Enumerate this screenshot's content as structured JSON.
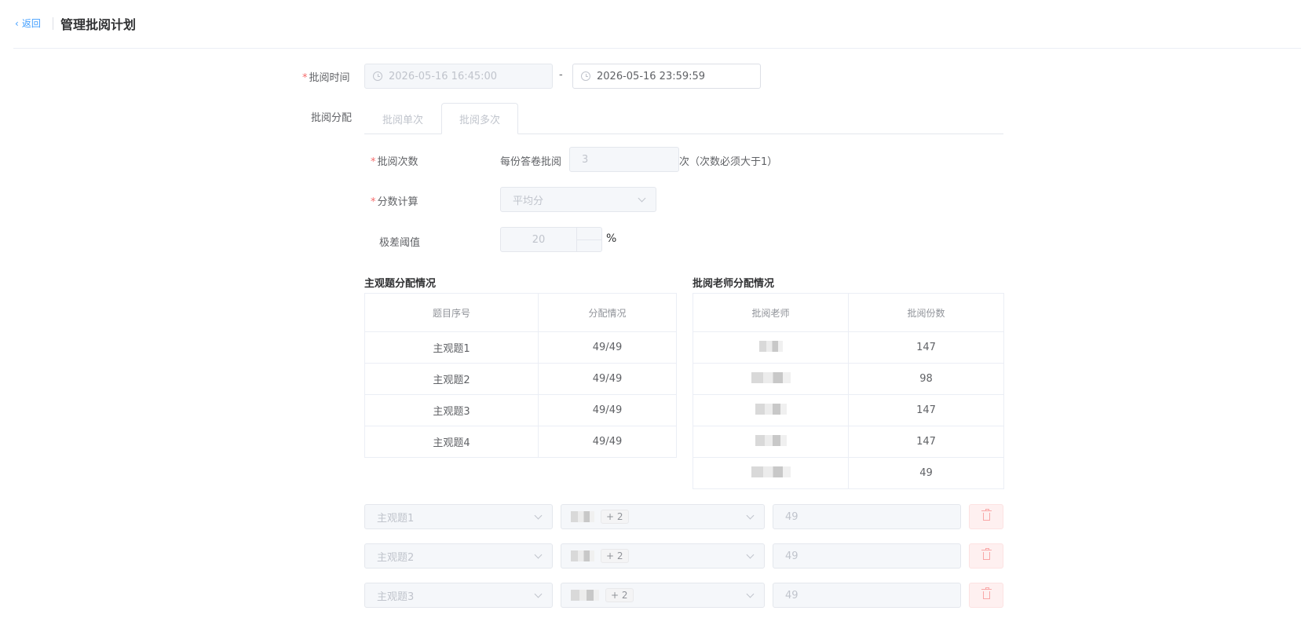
{
  "header": {
    "back_label": "返回",
    "title": "管理批阅计划"
  },
  "review_time": {
    "label": "批阅时间",
    "start": "2026-05-16 16:45:00",
    "separator": "-",
    "end": "2026-05-16 23:59:59"
  },
  "allocation": {
    "label": "批阅分配",
    "tabs": [
      "批阅单次",
      "批阅多次"
    ]
  },
  "review_count": {
    "label": "批阅次数",
    "prefix": "每份答卷批阅",
    "value": "3",
    "suffix": "次（次数必须大于1）"
  },
  "score_calc": {
    "label": "分数计算",
    "value": "平均分"
  },
  "range_threshold": {
    "label": "极差阈值",
    "value": "20",
    "unit": "%"
  },
  "subjective_table": {
    "title": "主观题分配情况",
    "headers": [
      "题目序号",
      "分配情况"
    ],
    "rows": [
      [
        "主观题1",
        "49/49"
      ],
      [
        "主观题2",
        "49/49"
      ],
      [
        "主观题3",
        "49/49"
      ],
      [
        "主观题4",
        "49/49"
      ]
    ]
  },
  "teacher_table": {
    "title": "批阅老师分配情况",
    "headers": [
      "批阅老师",
      "批阅份数"
    ],
    "rows": [
      "147",
      "98",
      "147",
      "147",
      "49"
    ]
  },
  "assign_rows": [
    {
      "question": "主观题1",
      "tag": "+ 2",
      "count": "49"
    },
    {
      "question": "主观题2",
      "tag": "+ 2",
      "count": "49"
    },
    {
      "question": "主观题3",
      "tag": "+ 2",
      "count": "49"
    }
  ]
}
